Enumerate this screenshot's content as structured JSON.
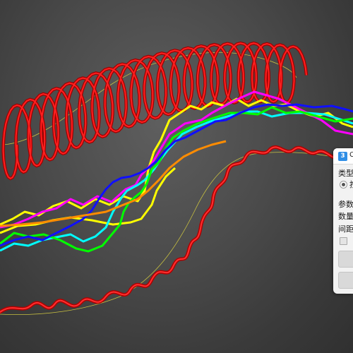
{
  "panel": {
    "title": "C",
    "type_label": "类型",
    "radio_option": "按",
    "params_label": "参数",
    "count_label": "数量",
    "spacing_label": "间距",
    "icon": "app-logo-icon"
  },
  "scene": {
    "background_color": "#474747",
    "helix_color": "#e01010",
    "path_color": "#c8c040",
    "wire_colors": [
      "#ffff00",
      "#ff00ff",
      "#00ffff",
      "#00ff00",
      "#0000ff",
      "#ff6000",
      "#ff0000"
    ]
  }
}
